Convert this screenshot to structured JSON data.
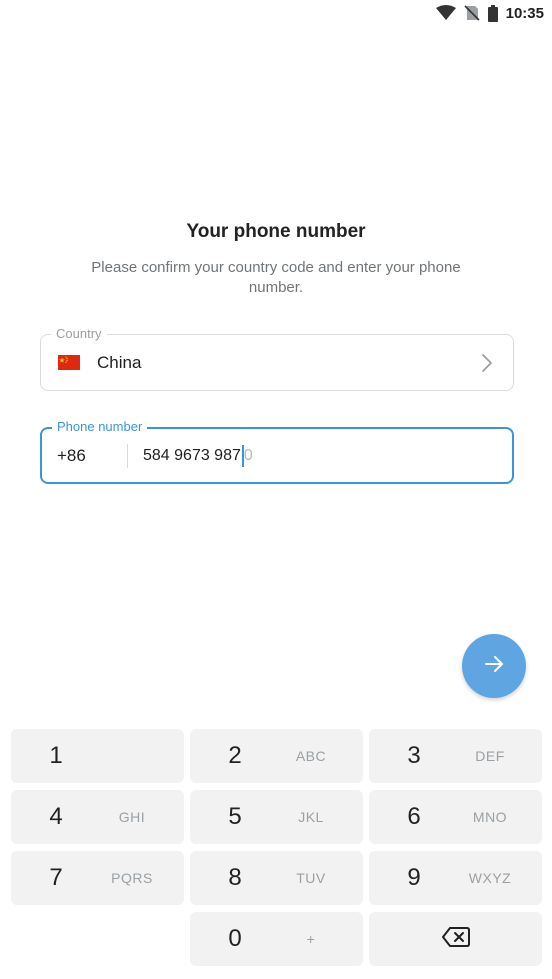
{
  "status_bar": {
    "time": "10:35",
    "icons": [
      "wifi-icon",
      "no-sim-icon",
      "battery-icon"
    ]
  },
  "screen": {
    "title": "Your phone number",
    "subtitle": "Please confirm your country code and enter your phone number."
  },
  "country_field": {
    "label": "Country",
    "value": "China",
    "flag": "china-flag-icon"
  },
  "phone_field": {
    "label": "Phone number",
    "country_code": "+86",
    "number_entered": "584 9673 987",
    "number_hint": "0"
  },
  "next_button": {
    "icon": "arrow-right-icon"
  },
  "keypad": {
    "keys": [
      {
        "digit": "1",
        "letters": ""
      },
      {
        "digit": "2",
        "letters": "ABC"
      },
      {
        "digit": "3",
        "letters": "DEF"
      },
      {
        "digit": "4",
        "letters": "GHI"
      },
      {
        "digit": "5",
        "letters": "JKL"
      },
      {
        "digit": "6",
        "letters": "MNO"
      },
      {
        "digit": "7",
        "letters": "PQRS"
      },
      {
        "digit": "8",
        "letters": "TUV"
      },
      {
        "digit": "9",
        "letters": "WXYZ"
      },
      {
        "digit": "0",
        "letters": "+"
      }
    ],
    "backspace_icon": "backspace-icon"
  },
  "colors": {
    "accent": "#3a95dd",
    "fab": "#5ea5e1",
    "key_background": "#f2f2f2",
    "secondary_text": "#707579"
  }
}
